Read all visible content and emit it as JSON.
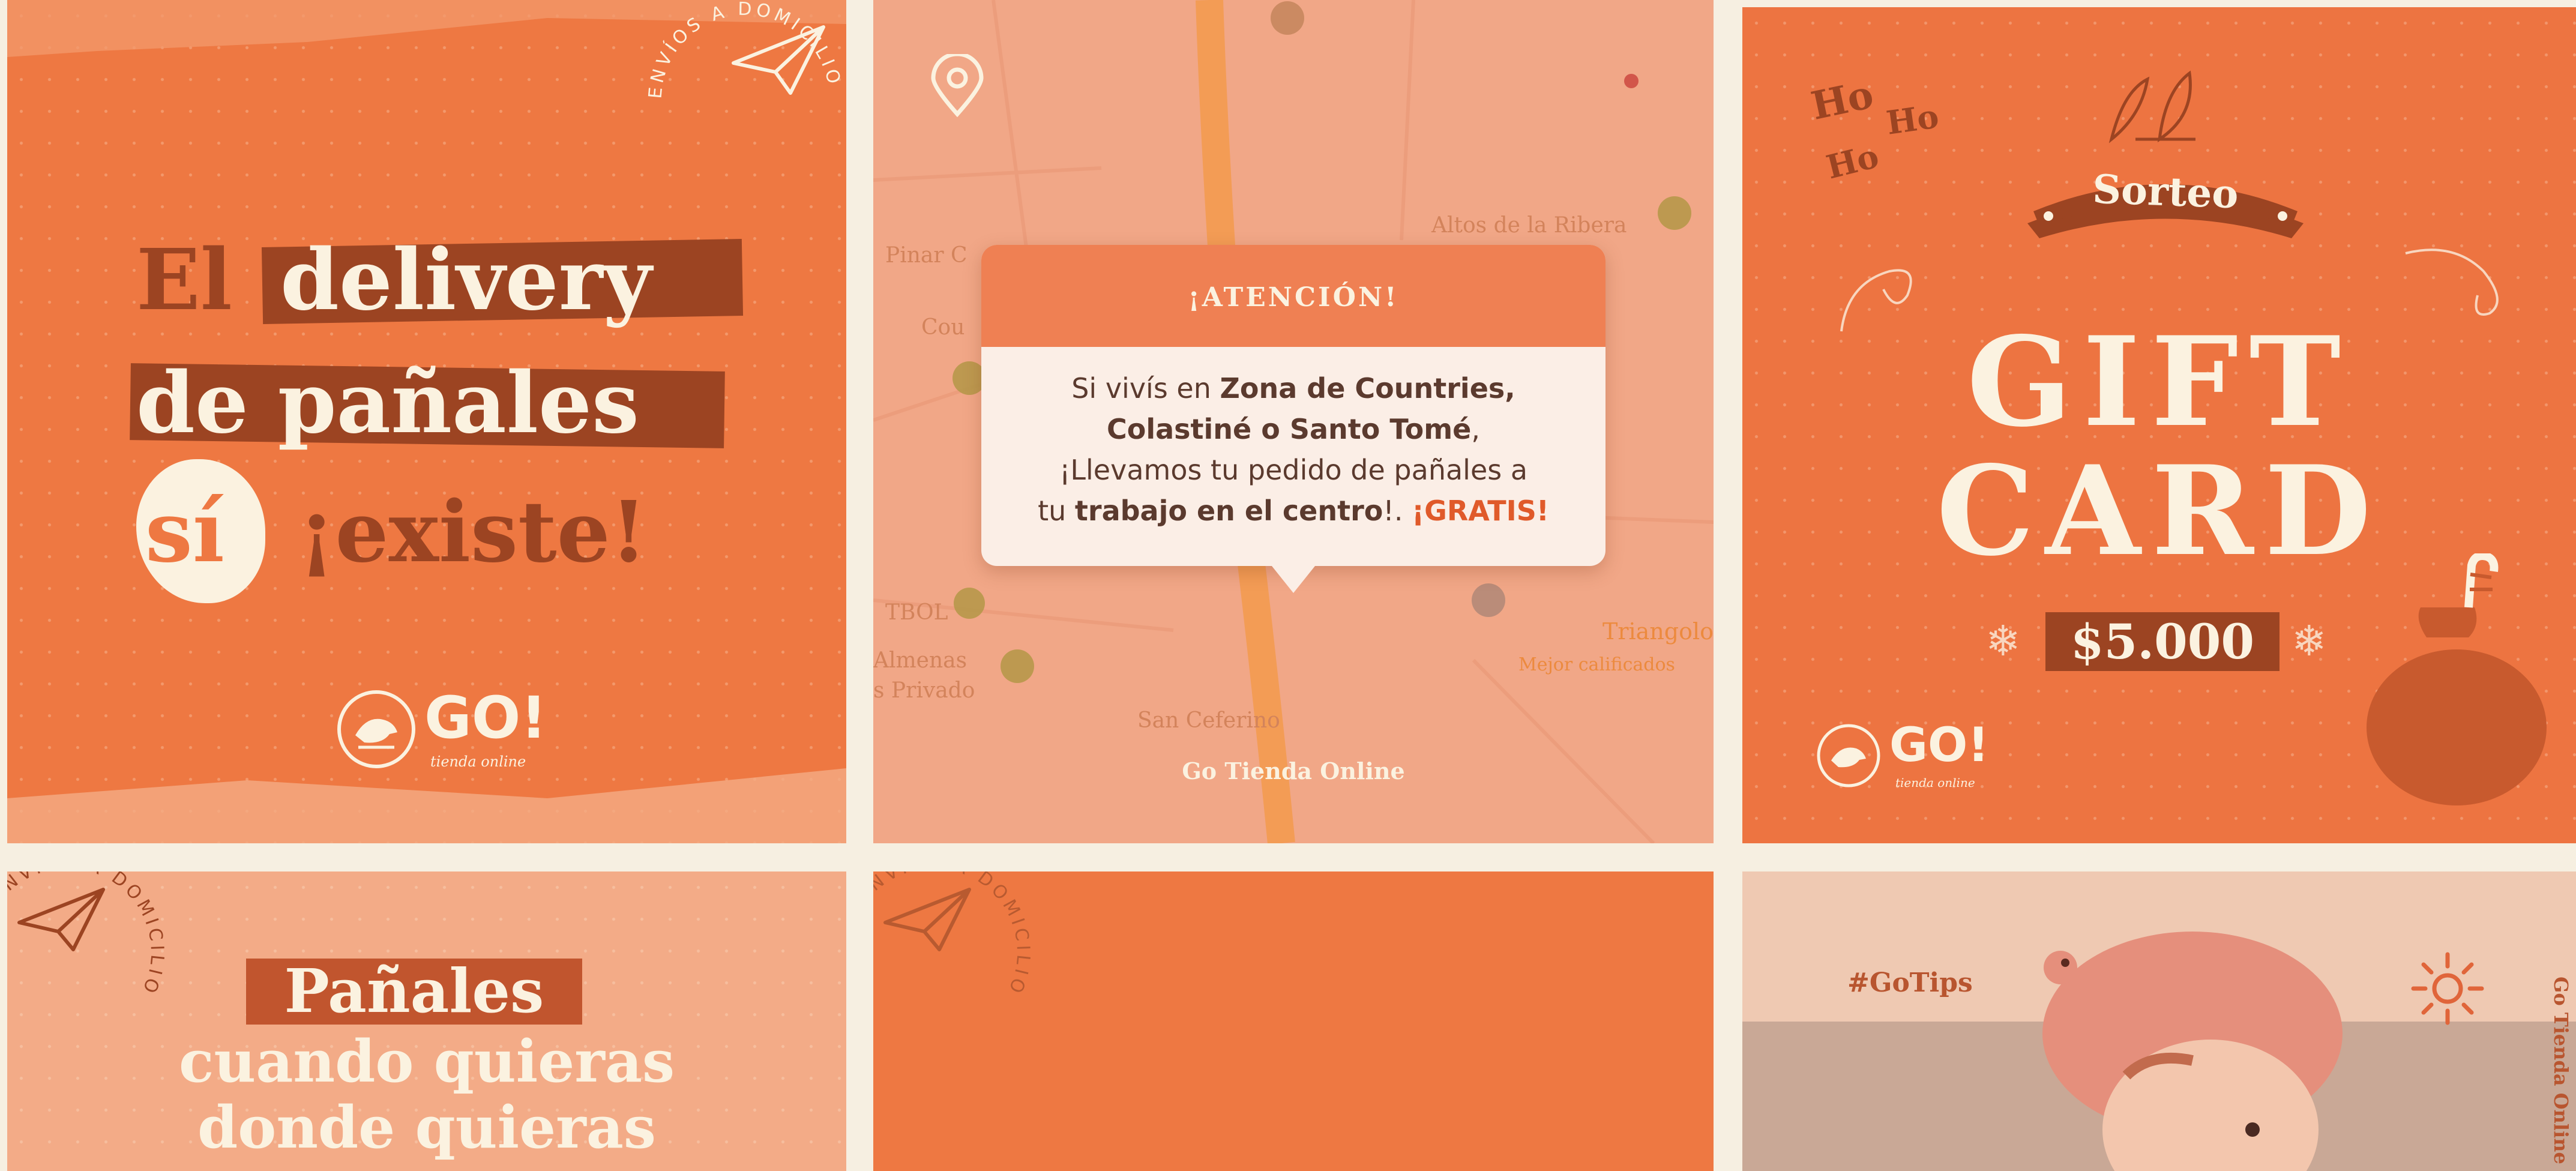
{
  "tile1": {
    "headline_el": "El",
    "headline_delivery": "delivery",
    "headline_line2": "de pañales",
    "headline_si": "sí",
    "headline_existe": "¡existe!",
    "stamp_text": "ENVÍOS A DOMICILIO",
    "logo_text": "GO!",
    "logo_sub": "tienda online"
  },
  "tile2": {
    "map_labels": [
      "Pinar C",
      "Altos de la Ribera",
      "Cou",
      "TBOL",
      "Almenas",
      "s Privado",
      "San Ceferino",
      "Triangolo",
      "Mejor calificados"
    ],
    "popup_title": "¡ATENCIÓN!",
    "popup_line1_a": "Si vivís en ",
    "popup_line1_b": "Zona de Countries,",
    "popup_line2_b": "Colastiné o Santo Tomé",
    "popup_line2_c": ",",
    "popup_line3": "¡Llevamos tu pedido de pañales a",
    "popup_line4_a": "tu ",
    "popup_line4_b": "trabajo en el centro",
    "popup_line4_c": "!. ",
    "popup_line4_d": "¡GRATIS!",
    "footer": "Go Tienda Online"
  },
  "tile3": {
    "ho_text": "Ho",
    "banner_text": "Sorteo",
    "title_line1": "GIFT",
    "title_line2": "CARD",
    "amount": "$5.000",
    "logo_text": "GO!",
    "logo_sub": "tienda online"
  },
  "tile4": {
    "stamp_text": "ENVÍOS A DOMICILIO",
    "word1": "Pañales",
    "line2": "cuando quieras",
    "line3": "donde quieras"
  },
  "tile5": {
    "stamp_text": "ENVÍOS A DOMICILIO"
  },
  "tile6": {
    "hashtag": "#GoTips",
    "vertical_text": "Go Tienda Online"
  },
  "colors": {
    "background": "#f6efe1",
    "orange": "#ee7842",
    "dark_brown": "#9c4422",
    "cream": "#fbf2e0",
    "peach": "#f2a782",
    "popup_header": "#ef8053",
    "gratis": "#e05a2a"
  }
}
